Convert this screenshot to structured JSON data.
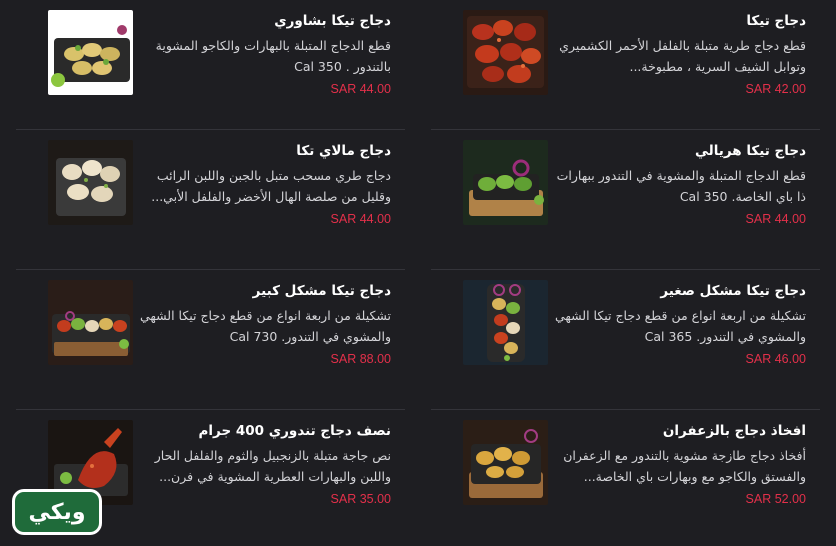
{
  "items": [
    {
      "title": "دجاج تيكا",
      "desc": "قطع دجاج طرية متبلة بالفلفل الأحمر الكشميري وتوابل الشيف السرية ، مطبوخة...",
      "price": "SAR 42.00",
      "image": "tikka"
    },
    {
      "title": "دجاج تيكا بشاوري",
      "desc": "قطع الدجاج المتبلة بالبهارات والكاجو المشوية بالتندور . Cal 350",
      "price": "SAR 44.00",
      "image": "peshawari"
    },
    {
      "title": "دجاج تيكا هريالي",
      "desc": "قطع الدجاج المتبلة والمشوية في التندور ببهارات ذا باي الخاصة. Cal 350",
      "price": "SAR 44.00",
      "image": "hariyali"
    },
    {
      "title": "دجاج مالاي تكا",
      "desc": "دجاج طري مسحب متبل بالجبن واللبن الرائب وقليل من صلصة الهال الأخضر والفلفل الأبي...",
      "price": "SAR 44.00",
      "image": "malai"
    },
    {
      "title": "دجاج تيكا مشكل صغير",
      "desc": "تشكيلة من اربعة انواع من قطع دجاج تيكا الشهي والمشوي في التندور. Cal 365",
      "price": "SAR 46.00",
      "image": "mix-small"
    },
    {
      "title": "دجاج تيكا مشكل كبير",
      "desc": "تشكيلة من اربعة انواع من قطع دجاج تيكا الشهي والمشوي في التندور. Cal 730",
      "price": "SAR 88.00",
      "image": "mix-large"
    },
    {
      "title": "افخاذ دجاج بالزعفران",
      "desc": "أفخاذ دجاج طازجة مشوية بالتندور مع الزعفران والفستق والكاجو مع وبهارات باي الخاصة...",
      "price": "SAR 52.00",
      "image": "saffron"
    },
    {
      "title": "نصف دجاج تندوري 400 جرام",
      "desc": "نص جاجة متبلة بالزنجبيل والثوم والفلفل الحار واللبن والبهارات العطرية المشوية في فرن...",
      "price": "SAR 35.00",
      "image": "tandoori"
    }
  ],
  "logo": {
    "text": "ويكي"
  }
}
